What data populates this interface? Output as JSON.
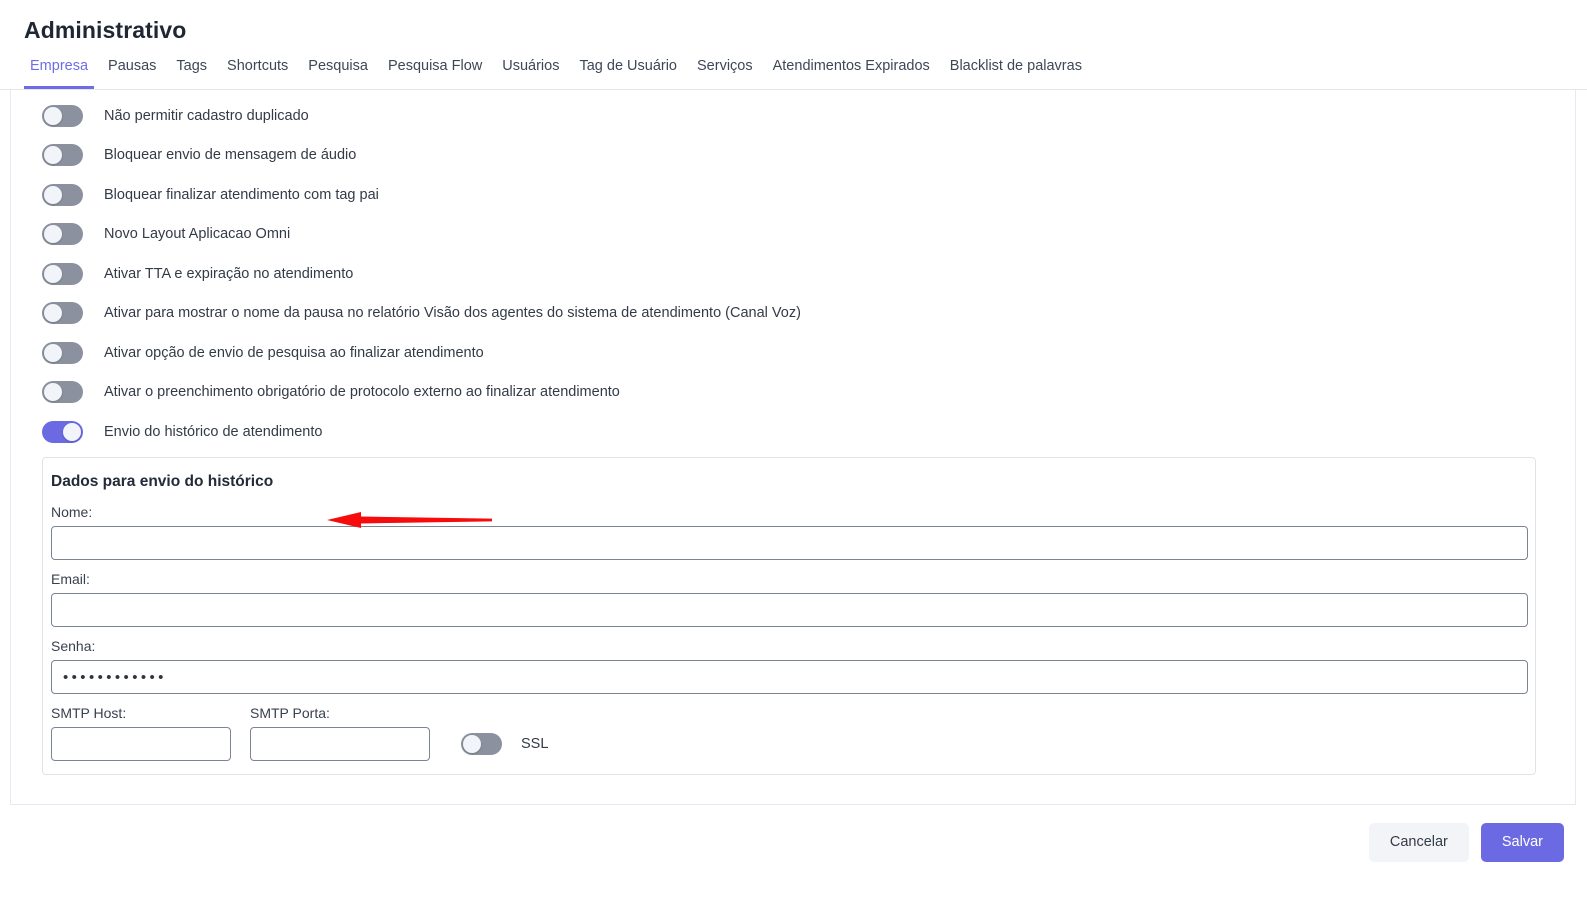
{
  "header": {
    "title": "Administrativo"
  },
  "tabs": [
    {
      "label": "Empresa",
      "active": true
    },
    {
      "label": "Pausas",
      "active": false
    },
    {
      "label": "Tags",
      "active": false
    },
    {
      "label": "Shortcuts",
      "active": false
    },
    {
      "label": "Pesquisa",
      "active": false
    },
    {
      "label": "Pesquisa Flow",
      "active": false
    },
    {
      "label": "Usuários",
      "active": false
    },
    {
      "label": "Tag de Usuário",
      "active": false
    },
    {
      "label": "Serviços",
      "active": false
    },
    {
      "label": "Atendimentos Expirados",
      "active": false
    },
    {
      "label": "Blacklist de palavras",
      "active": false
    }
  ],
  "settings": {
    "toggles": [
      {
        "label": "Não permitir cadastro duplicado",
        "on": false
      },
      {
        "label": "Bloquear envio de mensagem de áudio",
        "on": false
      },
      {
        "label": "Bloquear finalizar atendimento com tag pai",
        "on": false
      },
      {
        "label": "Novo Layout Aplicacao Omni",
        "on": false
      },
      {
        "label": "Ativar TTA e expiração no atendimento",
        "on": false
      },
      {
        "label": "Ativar para mostrar o nome da pausa no relatório Visão dos agentes do sistema de atendimento (Canal Voz)",
        "on": false
      },
      {
        "label": "Ativar opção de envio de pesquisa ao finalizar atendimento",
        "on": false
      },
      {
        "label": "Ativar o preenchimento obrigatório de protocolo externo ao finalizar atendimento",
        "on": false
      },
      {
        "label": "Envio do histórico de atendimento",
        "on": true
      }
    ]
  },
  "history_card": {
    "title": "Dados para envio do histórico",
    "name": {
      "label": "Nome:",
      "value": "",
      "placeholder": ""
    },
    "email": {
      "label": "Email:",
      "value": "",
      "placeholder": ""
    },
    "password": {
      "label": "Senha:",
      "value": "••••••••••••",
      "placeholder": ""
    },
    "smtp_host": {
      "label": "SMTP Host:",
      "value": "",
      "placeholder": ""
    },
    "smtp_port": {
      "label": "SMTP Porta:",
      "value": "",
      "placeholder": ""
    },
    "ssl": {
      "label": "SSL",
      "on": false
    }
  },
  "footer": {
    "cancel_label": "Cancelar",
    "save_label": "Salvar"
  },
  "annotation": {
    "type": "arrow",
    "direction": "left",
    "color": "#f60c0c",
    "points_to": "Envio do histórico de atendimento"
  },
  "colors": {
    "accent": "#6c6ae3",
    "toggle_off": "#8c919f",
    "annotation_red": "#f60c0c"
  }
}
